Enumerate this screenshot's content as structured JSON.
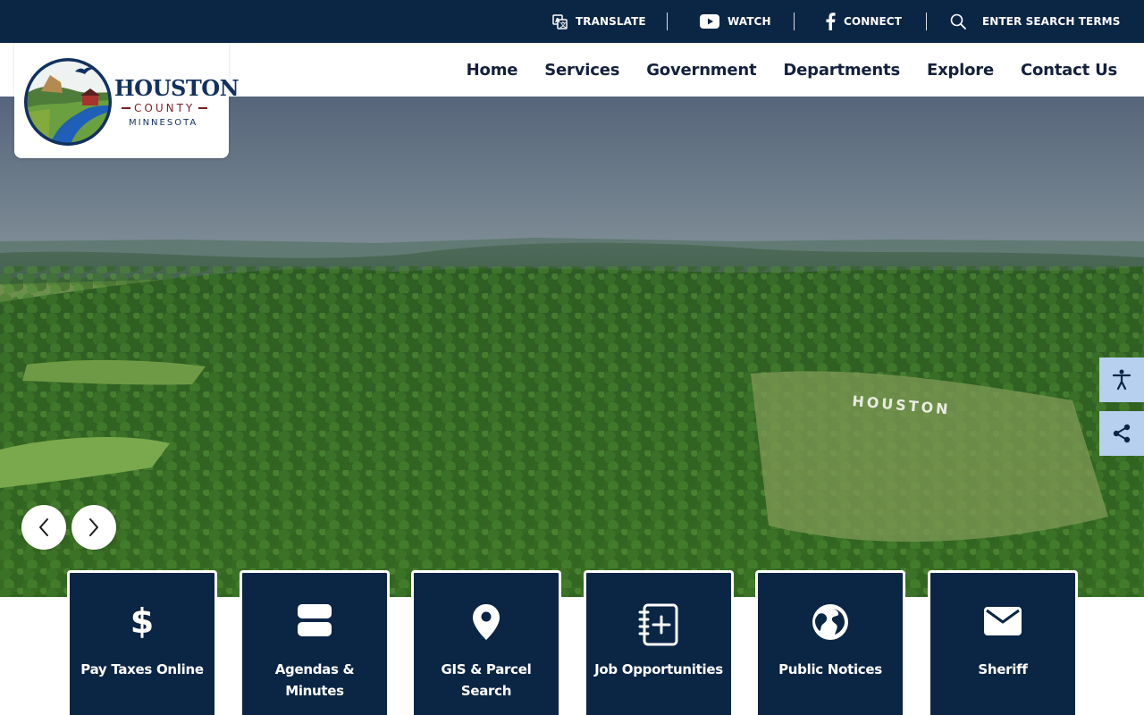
{
  "utility_bar": {
    "translate": "TRANSLATE",
    "watch": "WATCH",
    "connect": "CONNECT",
    "search": "ENTER SEARCH TERMS"
  },
  "logo": {
    "title": "HOUSTON",
    "county": "COUNTY",
    "state": "MINNESOTA"
  },
  "nav": [
    "Home",
    "Services",
    "Government",
    "Departments",
    "Explore",
    "Contact Us"
  ],
  "hero": {
    "hillside_text": "HOUSTON"
  },
  "quick_links": [
    {
      "label": "Pay Taxes Online",
      "icon": "dollar-icon"
    },
    {
      "label": "Agendas & Minutes",
      "icon": "stacked-rectangles-icon"
    },
    {
      "label": "GIS & Parcel Search",
      "icon": "map-pin-icon"
    },
    {
      "label": "Job Opportunities",
      "icon": "notebook-plus-icon"
    },
    {
      "label": "Public Notices",
      "icon": "globe-icon"
    },
    {
      "label": "Sheriff",
      "icon": "envelope-icon"
    }
  ],
  "colors": {
    "navy": "#0b2545",
    "side_button": "#b7d0f0",
    "logo_blue": "#12315f",
    "logo_red": "#7a1f22"
  }
}
